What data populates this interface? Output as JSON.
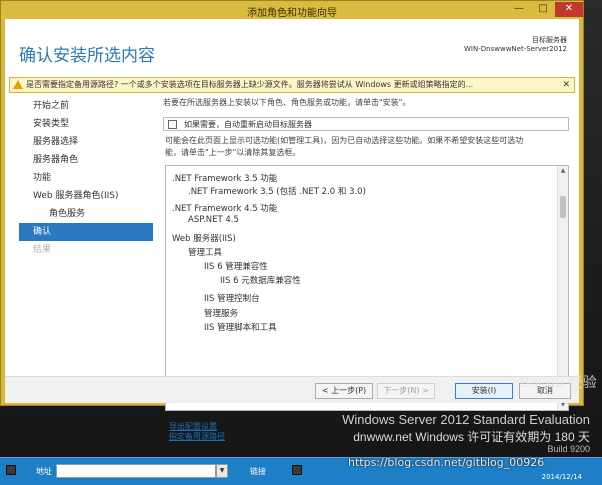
{
  "window": {
    "title": "添加角色和功能向导",
    "controls": {
      "minimize": "—",
      "maximize": "□",
      "close": "✕"
    }
  },
  "header": {
    "title": "确认安装所选内容",
    "dest_label": "目标服务器",
    "dest_server": "WIN-DnswwwNet-Server2012"
  },
  "warning": {
    "text": "是否需要指定备用源路径? 一个或多个安装选项在目标服务器上缺少源文件。服务器将尝试从 Windows 更新或组策略指定的...",
    "close_icon": "✕"
  },
  "nav": {
    "items": [
      {
        "label": "开始之前",
        "state": "normal",
        "sub": false
      },
      {
        "label": "安装类型",
        "state": "normal",
        "sub": false
      },
      {
        "label": "服务器选择",
        "state": "normal",
        "sub": false
      },
      {
        "label": "服务器角色",
        "state": "normal",
        "sub": false
      },
      {
        "label": "功能",
        "state": "normal",
        "sub": false
      },
      {
        "label": "Web 服务器角色(IIS)",
        "state": "normal",
        "sub": false
      },
      {
        "label": "角色服务",
        "state": "normal",
        "sub": true
      },
      {
        "label": "确认",
        "state": "active",
        "sub": false
      },
      {
        "label": "结果",
        "state": "disabled",
        "sub": false
      }
    ]
  },
  "content": {
    "intro": "若要在所选服务器上安装以下角色、角色服务或功能，请单击\"安装\"。",
    "restart_label": "如果需要，自动重新启动目标服务器",
    "info_line1": "可能会在此页面上显示可选功能(如管理工具)，因为已自动选择这些功能。如果不希望安装这些可选功",
    "info_line2": "能，请单击\"上一步\"以清除其复选框。",
    "features": [
      {
        "text": ".NET Framework 3.5 功能",
        "level": 0
      },
      {
        "text": ".NET Framework 3.5 (包括 .NET 2.0 和 3.0)",
        "level": 1
      },
      {
        "text": ".NET Framework 4.5 功能",
        "level": 0
      },
      {
        "text": "ASP.NET 4.5",
        "level": 1
      },
      {
        "text": "Web 服务器(IIS)",
        "level": 0
      },
      {
        "text": "管理工具",
        "level": 1
      },
      {
        "text": "IIS 6 管理兼容性",
        "level": 2
      },
      {
        "text": "IIS 6 元数据库兼容性",
        "level": 3
      },
      {
        "text": "IIS 管理控制台",
        "level": 2
      },
      {
        "text": "管理服务",
        "level": 2
      },
      {
        "text": "IIS 管理脚本和工具",
        "level": 2
      }
    ],
    "scroll_up": "▲",
    "scroll_down": "▼",
    "export_link": "导出配置设置",
    "alt_source_link": "指定备用源路径"
  },
  "buttons": {
    "prev": "< 上一步(P)",
    "next": "下一步(N) >",
    "install": "安装(I)",
    "cancel": "取消"
  },
  "desktop": {
    "line1": "Windows Server 2012 Standard Evaluation",
    "line2": "dnwww.net Windows 许可证有效期为 180 天",
    "line3": "Build 9200"
  },
  "taskbar": {
    "address_label": "地址",
    "links_label": "链接",
    "date": "2014/12/14"
  },
  "watermark": "https://blog.csdn.net/gitblog_00926",
  "baidu": "Bai du 经验",
  "colors": {
    "accent": "#2a78c0",
    "title_blue": "#2c7ab8",
    "titlebar_yellow": "#d9bc3f",
    "warning_bg": "#fff6c8",
    "taskbar": "#1f7fc6"
  }
}
